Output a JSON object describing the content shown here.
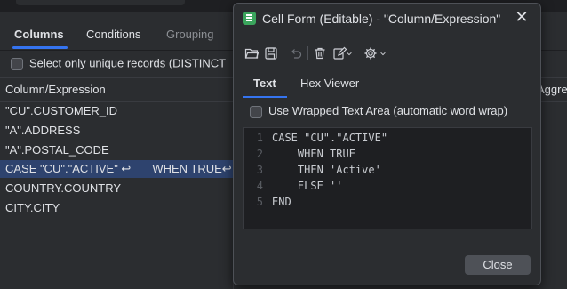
{
  "background": {
    "tabs": [
      {
        "label": "Columns",
        "active": true
      },
      {
        "label": "Conditions",
        "active": false
      },
      {
        "label": "Grouping",
        "active": false
      }
    ],
    "distinct_label": "Select only unique records (DISTINCT",
    "grid_header": {
      "col1": "Column/Expression",
      "col2": "Aggre"
    },
    "rows": [
      {
        "text": "\"CU\".CUSTOMER_ID",
        "selected": false
      },
      {
        "text": "\"A\".ADDRESS",
        "selected": false
      },
      {
        "text": "\"A\".POSTAL_CODE",
        "selected": false
      },
      {
        "text": "CASE \"CU\".\"ACTIVE\" ↩",
        "extra": "WHEN TRUE↩",
        "selected": true
      },
      {
        "text": "COUNTRY.COUNTRY",
        "selected": false
      },
      {
        "text": "CITY.CITY",
        "selected": false
      }
    ]
  },
  "dialog": {
    "title": "Cell Form (Editable) - \"Column/Expression\"",
    "toolbar_icons": [
      "open-folder-icon",
      "save-icon",
      "undo-icon",
      "delete-icon",
      "edit-icon",
      "settings-icon"
    ],
    "tabs": [
      {
        "label": "Text",
        "active": true
      },
      {
        "label": "Hex Viewer",
        "active": false
      }
    ],
    "wrap_label": "Use Wrapped Text Area (automatic word wrap)",
    "code_lines": [
      {
        "num": "1",
        "text": "CASE \"CU\".\"ACTIVE\""
      },
      {
        "num": "2",
        "text": "    WHEN TRUE"
      },
      {
        "num": "3",
        "text": "    THEN 'Active'"
      },
      {
        "num": "4",
        "text": "    ELSE ''"
      },
      {
        "num": "5",
        "text": "END"
      }
    ],
    "close_button": "Close"
  },
  "colors": {
    "accent": "#3574f0",
    "selection": "#2e436e",
    "app_icon": "#3ba55d"
  }
}
